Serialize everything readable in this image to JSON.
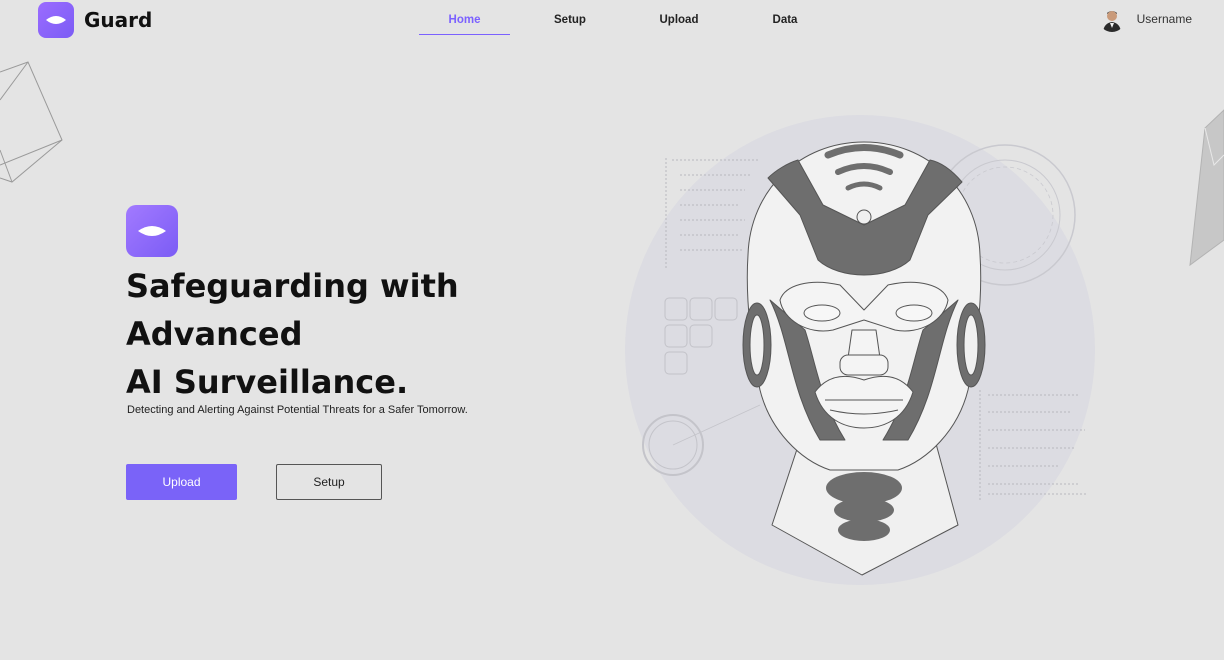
{
  "brand": {
    "name": "Guard",
    "logo_icon": "eye-icon"
  },
  "nav": {
    "items": [
      {
        "label": "Home",
        "active": true
      },
      {
        "label": "Setup",
        "active": false
      },
      {
        "label": "Upload",
        "active": false
      },
      {
        "label": "Data",
        "active": false
      }
    ]
  },
  "user": {
    "name": "Username",
    "avatar_icon": "user-avatar"
  },
  "hero": {
    "logo_icon": "eye-icon",
    "title_line1": "Safeguarding with Advanced",
    "title_line2": "AI Surveillance.",
    "subtitle": "Detecting and Alerting Against Potential Threats for a Safer Tomorrow.",
    "upload_label": "Upload",
    "setup_label": "Setup"
  },
  "colors": {
    "accent": "#7a63f8",
    "background": "#e4e4e4",
    "robot_dark": "#6e6e6e"
  }
}
